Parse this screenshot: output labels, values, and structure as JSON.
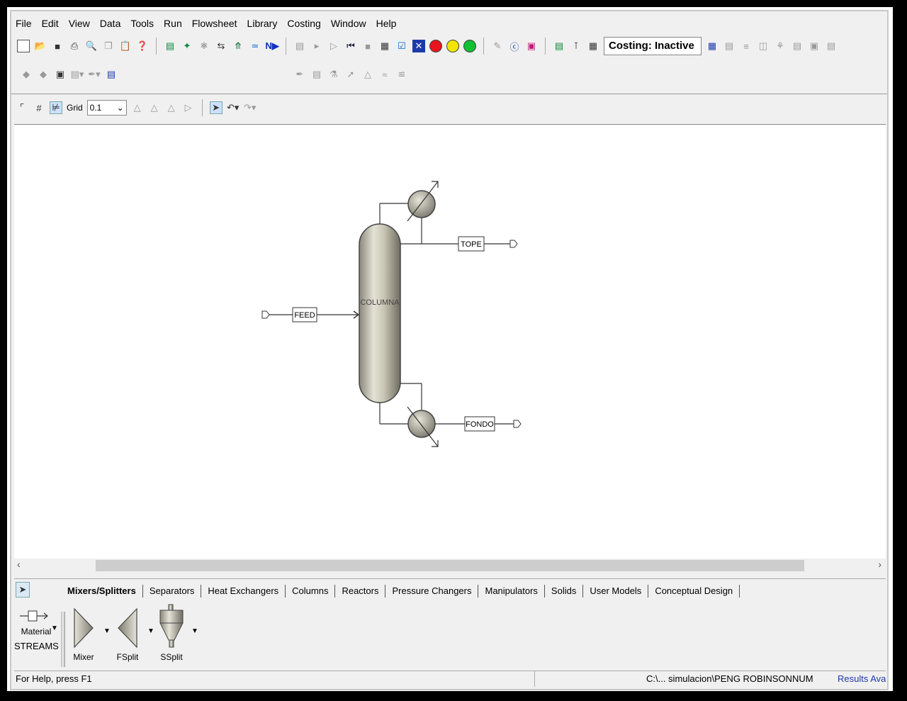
{
  "menu": [
    "File",
    "Edit",
    "View",
    "Data",
    "Tools",
    "Run",
    "Flowsheet",
    "Library",
    "Costing",
    "Window",
    "Help"
  ],
  "toolbar": {
    "costing_status": "Costing: Inactive",
    "grid_label": "Grid",
    "grid_value": "0.1"
  },
  "flowsheet": {
    "column_label": "COLUMNA",
    "feed_label": "FEED",
    "top_label": "TOPE",
    "bottom_label": "FONDO"
  },
  "palette": {
    "tabs": [
      "Mixers/Splitters",
      "Separators",
      "Heat Exchangers",
      "Columns",
      "Reactors",
      "Pressure Changers",
      "Manipulators",
      "Solids",
      "User Models",
      "Conceptual Design"
    ],
    "active_tab": "Mixers/Splitters",
    "streams_label_1": "Material",
    "streams_label_2": "STREAMS",
    "models": [
      "Mixer",
      "FSplit",
      "SSplit"
    ]
  },
  "statusbar": {
    "help": "For Help, press F1",
    "path": "C:\\... simulacion\\PENG ROBINSON",
    "num": "NUM",
    "results": "Results Availab"
  },
  "colors": {
    "red_light": "#e8141e",
    "yellow_light": "#f2e600",
    "green_light": "#10c030",
    "equipment_fill": "#c9c6b4"
  }
}
